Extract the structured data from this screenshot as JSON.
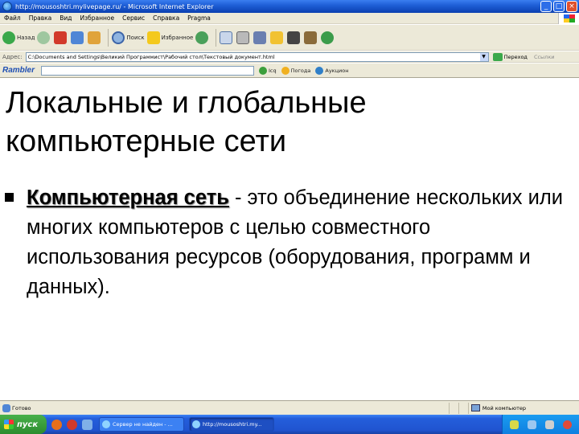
{
  "window": {
    "title": "http://mousoshtri.mylivepage.ru/ - Microsoft Internet Explorer"
  },
  "menu": [
    "Файл",
    "Правка",
    "Вид",
    "Избранное",
    "Сервис",
    "Справка",
    "Pragma"
  ],
  "toolbar": {
    "back": "Назад",
    "search": "Поиск",
    "favorites": "Избранное"
  },
  "address": {
    "label": "Адрес:",
    "value": "C:\\Documents and Settings\\Великий Программист\\Рабочий стол\\Текстовый документ.html",
    "go": "Переход",
    "links": "Ссылки"
  },
  "rambler": {
    "logo": "Rambler",
    "buttons": [
      "Icq",
      "Погода",
      "Аукцион"
    ]
  },
  "slide": {
    "title": "Локальные и глобальные компьютерные сети",
    "term": "Компьютерная сеть",
    "definition": " - это объединение нескольких или многих компьютеров с целью совместного использования ресурсов (оборудования, программ и данных)."
  },
  "status": {
    "left": "Готово",
    "zone": "Мой компьютер"
  },
  "taskbar": {
    "start": "пуск",
    "tasks": [
      "Сервер не найден - ...",
      "http://mousoshtri.my..."
    ]
  },
  "icons": {
    "ie": "internet-explorer-icon",
    "back": "back-arrow-icon",
    "forward": "forward-arrow-icon",
    "stop": "stop-icon",
    "refresh": "refresh-icon",
    "home": "home-icon",
    "search": "search-icon",
    "favorites": "star-icon",
    "history": "history-icon",
    "mail": "mail-icon",
    "print": "print-icon",
    "edit": "edit-icon",
    "go": "go-arrow-icon",
    "my_computer": "computer-icon",
    "windows": "windows-flag-icon"
  },
  "colors": {
    "titlebar": "#245edb",
    "taskbar": "#2054d0",
    "start_button": "#3a9d3c",
    "chrome": "#ece9d8",
    "content_bg": "#ffffff"
  }
}
